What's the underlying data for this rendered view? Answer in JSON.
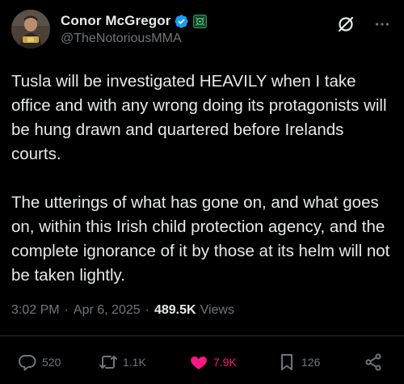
{
  "author": {
    "display_name": "Conor McGregor",
    "handle": "@TheNotoriousMMA",
    "verified_icon": "verified-badge-icon",
    "affiliation_icon": "affiliate-badge-icon",
    "accent_color": "#1d9bf0"
  },
  "header": {
    "grok_icon": "grok-icon",
    "more_icon": "more-options-icon"
  },
  "tweet": {
    "text": "Tusla will be investigated HEAVILY when I take office and with any wrong doing its protagonists will be hung drawn and quartered before Irelands courts.\n\nThe utterings of what has gone on, and what goes on, within this Irish child protection agency, and the complete ignorance of it by those at its helm will not be taken lightly."
  },
  "meta": {
    "time": "3:02 PM",
    "separator": "·",
    "date": "Apr 6, 2025",
    "views_count": "489.5K",
    "views_label": "Views"
  },
  "actions": {
    "replies": "520",
    "reposts": "1.1K",
    "likes": "7.9K",
    "bookmarks": "126",
    "like_color": "#f91880",
    "muted_color": "#71767b"
  }
}
